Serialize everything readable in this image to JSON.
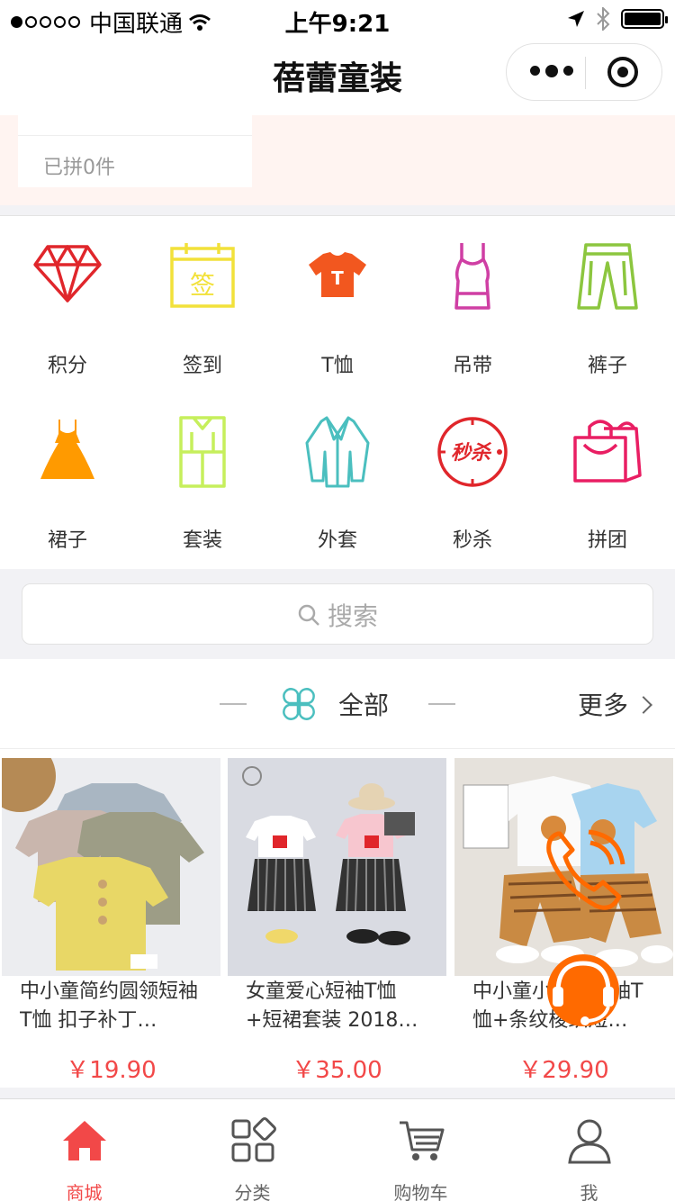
{
  "status_bar": {
    "carrier": "中国联通",
    "time": "上午9:21"
  },
  "nav": {
    "title": "蓓蕾童装"
  },
  "group_buy": {
    "joined_text": "已拼0件"
  },
  "categories": [
    {
      "label": "积分",
      "icon": "diamond-icon",
      "color": "#e0262b"
    },
    {
      "label": "签到",
      "icon": "calendar-sign-icon",
      "color": "#f2e13a"
    },
    {
      "label": "T恤",
      "icon": "tshirt-icon",
      "color": "#f2571f"
    },
    {
      "label": "吊带",
      "icon": "camisole-icon",
      "color": "#cf3fa4"
    },
    {
      "label": "裤子",
      "icon": "pants-icon",
      "color": "#8cc63f"
    },
    {
      "label": "裙子",
      "icon": "dress-icon",
      "color": "#ff9a00"
    },
    {
      "label": "套装",
      "icon": "suit-set-icon",
      "color": "#c6ef5c"
    },
    {
      "label": "外套",
      "icon": "coat-icon",
      "color": "#4bbfbf"
    },
    {
      "label": "秒杀",
      "icon": "flash-sale-icon",
      "color": "#e0262b"
    },
    {
      "label": "拼团",
      "icon": "shopping-bag-icon",
      "color": "#e91e63"
    }
  ],
  "search": {
    "placeholder": "搜索"
  },
  "section": {
    "title": "全部",
    "more": "更多"
  },
  "products": [
    {
      "name": "中小童简约圆领短袖T恤 扣子补丁…",
      "price": "￥19.90"
    },
    {
      "name": "女童爱心短袖T恤+短裙套装 2018…",
      "price": "￥35.00"
    },
    {
      "name": "中小童小狮子短袖T恤+条纹梭织短…",
      "price": "￥29.90"
    }
  ],
  "tabs": [
    {
      "label": "商城",
      "active": true
    },
    {
      "label": "分类",
      "active": false
    },
    {
      "label": "购物车",
      "active": false
    },
    {
      "label": "我",
      "active": false
    }
  ],
  "colors": {
    "accent": "#f24848",
    "float_orange": "#ff6a00"
  }
}
